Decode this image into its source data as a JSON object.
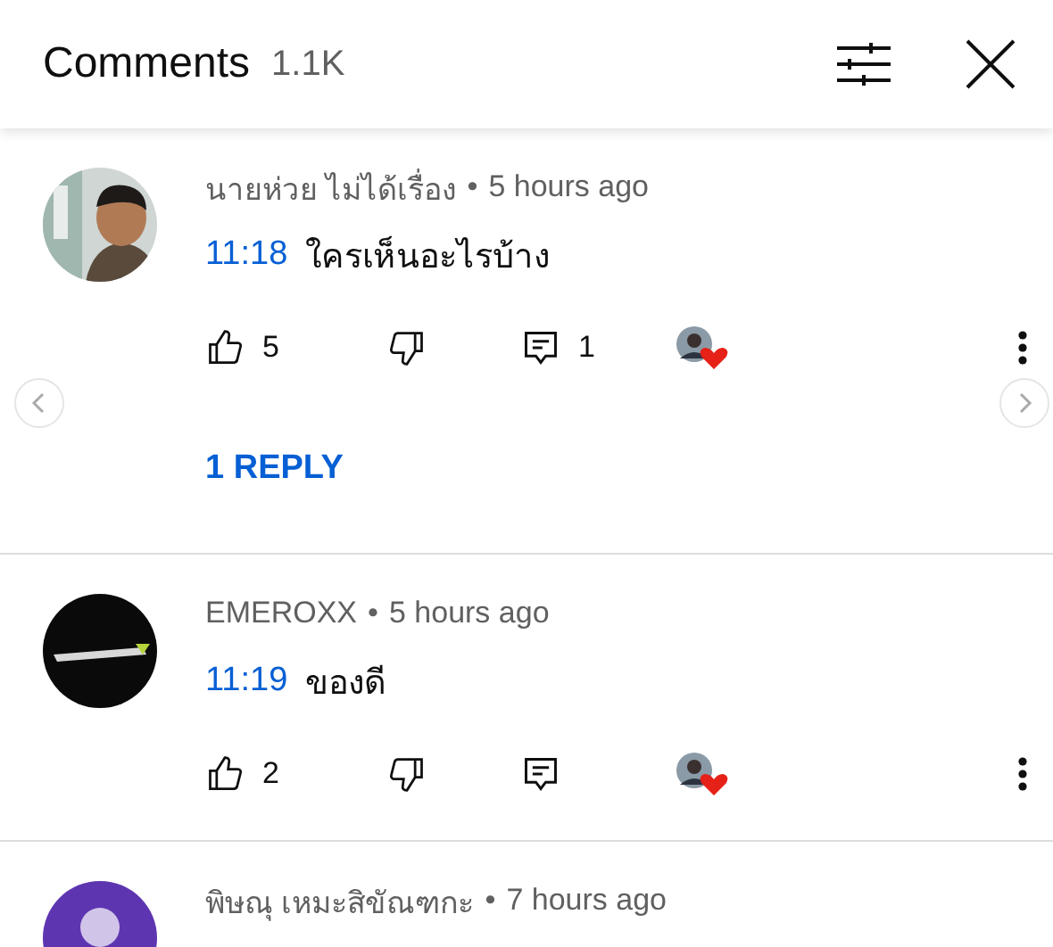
{
  "header": {
    "title": "Comments",
    "count": "1.1K"
  },
  "comments": [
    {
      "author": "นายห่วย ไม่ได้เรื่อง",
      "separator": "•",
      "time": "5 hours ago",
      "timestamp": "11:18",
      "text": "ใครเห็นอะไรบ้าง",
      "likes": "5",
      "reply_count": "1",
      "hearted": true,
      "reply_link": "1 REPLY",
      "carousel": true
    },
    {
      "kind": "logo",
      "author": "EMEROXX",
      "separator": "•",
      "time": "5 hours ago",
      "timestamp": "11:19",
      "text": "ของดี",
      "likes": "2",
      "hearted": true
    },
    {
      "kind": "default",
      "author": "พิษณุ เหมะสิขัณฑกะ",
      "separator": "•",
      "time": "7 hours ago"
    }
  ]
}
